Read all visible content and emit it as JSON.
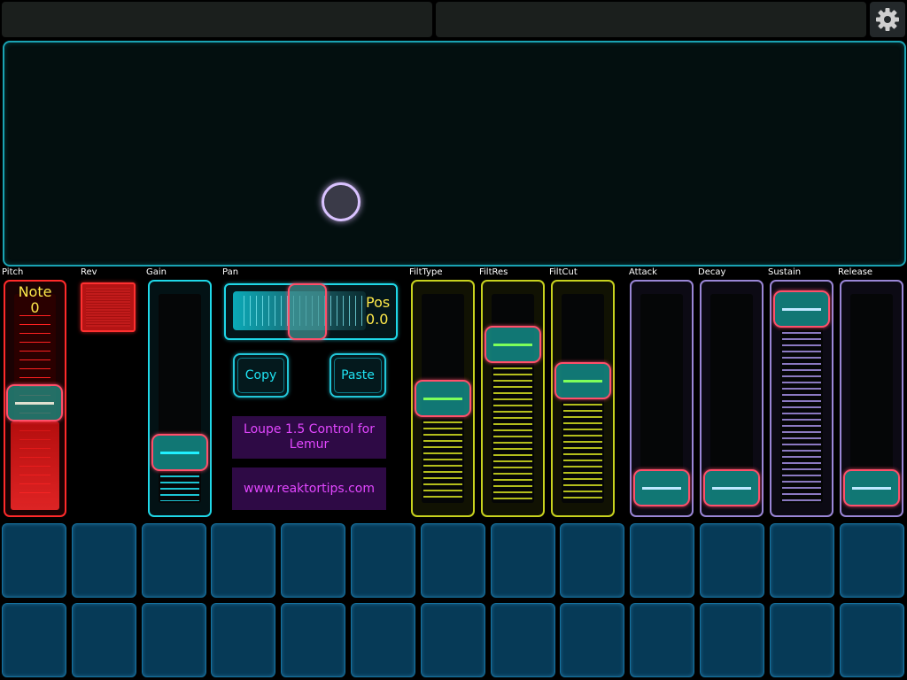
{
  "settings": {
    "icon": "gear-icon"
  },
  "labels": {
    "pitch": "Pitch",
    "rev": "Rev",
    "gain": "Gain",
    "pan": "Pan",
    "filttype": "FiltType",
    "filtres": "FiltRes",
    "filtcut": "FiltCut",
    "attack": "Attack",
    "decay": "Decay",
    "sustain": "Sustain",
    "release": "Release"
  },
  "pitch": {
    "title": "Note",
    "value": "0",
    "level": 0.5
  },
  "pan": {
    "title": "Pos",
    "value": "0.0",
    "level": 0.5
  },
  "buttons": {
    "copy": "Copy",
    "paste": "Paste"
  },
  "info": {
    "title": "Loupe 1.5 Control for Lemur",
    "url": "www.reaktortips.com"
  },
  "faders": {
    "gain": 0.2,
    "filttype": 0.5,
    "filtres": 0.8,
    "filtcut": 0.6,
    "attack": 0.0,
    "decay": 0.0,
    "sustain": 1.0,
    "release": 0.0
  },
  "colors": {
    "red": "#ff2a2a",
    "cyan": "#1fd8e8",
    "yellow": "#c8d21e",
    "lavender": "#9a86d6",
    "handle_border": "#ff4f6a",
    "pad_blue": "#063a57"
  },
  "grid": {
    "rows": 2,
    "cols": 13
  }
}
